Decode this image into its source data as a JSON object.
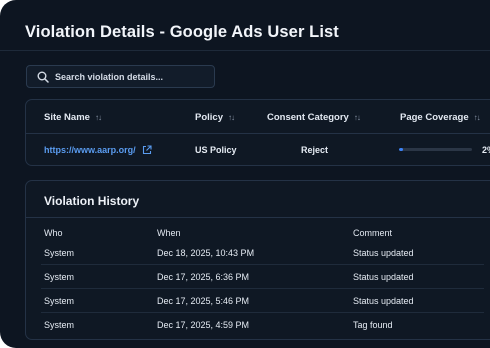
{
  "title": "Violation Details - Google Ads User List",
  "search": {
    "placeholder": "Search violation details..."
  },
  "sites_table": {
    "columns": [
      "Site Name",
      "Policy",
      "Consent Category",
      "Page Coverage"
    ],
    "rows": [
      {
        "site": "https://www.aarp.org/",
        "policy": "US Policy",
        "consent": "Reject",
        "coverage_fraction": 0.02,
        "coverage_text": "2%"
      }
    ]
  },
  "history": {
    "title": "Violation History",
    "columns": [
      "Who",
      "When",
      "Comment"
    ],
    "rows": [
      {
        "who": "System",
        "when": "Dec 18, 2025, 10:43 PM",
        "comment": "Status updated"
      },
      {
        "who": "System",
        "when": "Dec 17, 2025, 6:36 PM",
        "comment": "Status updated"
      },
      {
        "who": "System",
        "when": "Dec 17, 2025, 5:46 PM",
        "comment": "Status updated"
      },
      {
        "who": "System",
        "when": "Dec 17, 2025, 4:59 PM",
        "comment": "Tag found"
      }
    ]
  },
  "colors": {
    "background": "#0d1521",
    "link": "#5a9cf0",
    "progress": "#3b82f6"
  },
  "icons": {
    "search": "search-icon",
    "external": "external-link-icon",
    "sort": "sort-icon"
  }
}
